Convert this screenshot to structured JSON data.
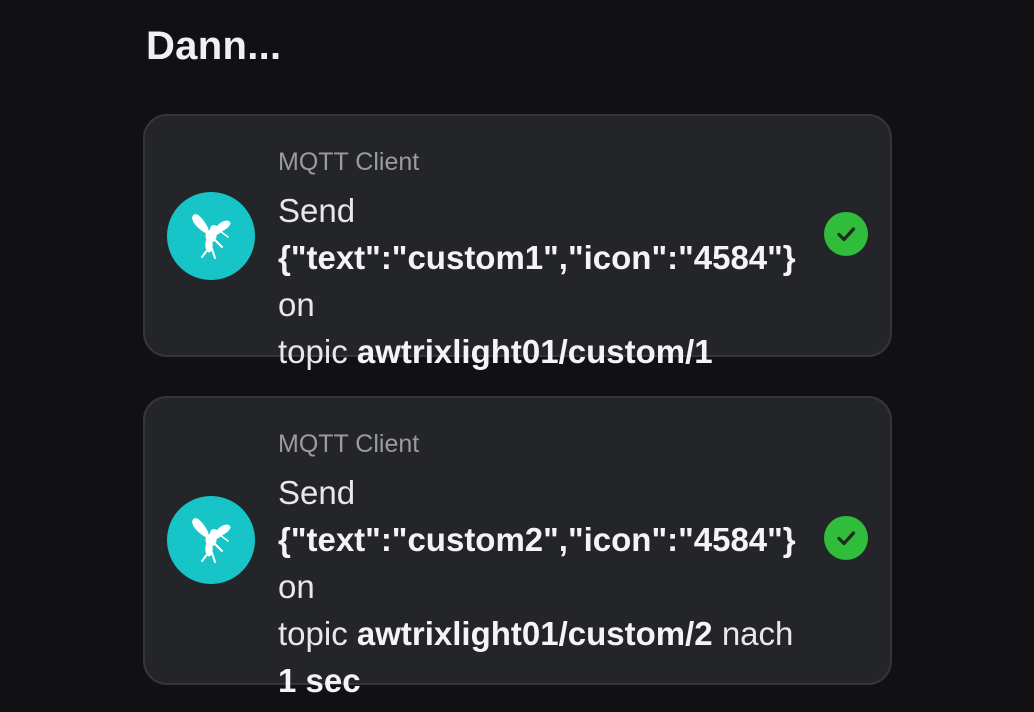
{
  "section": {
    "title": "Dann..."
  },
  "colors": {
    "background": "#111114",
    "card": "#242529",
    "icon_bg": "#17c4c8",
    "success": "#2fbd3b"
  },
  "actions": [
    {
      "app": "MQTT Client",
      "icon": "mosquitto-icon",
      "status_icon": "check-circle-icon",
      "send": "Send",
      "payload": "{\"text\":\"custom1\",\"icon\":\"4584\"}",
      "on": "on",
      "topic_label": "topic",
      "topic": "awtrixlight01/custom/1"
    },
    {
      "app": "MQTT Client",
      "icon": "mosquitto-icon",
      "status_icon": "check-circle-icon",
      "send": "Send",
      "payload": "{\"text\":\"custom2\",\"icon\":\"4584\"}",
      "on": "on",
      "topic_label": "topic",
      "topic": "awtrixlight01/custom/2",
      "delay_label": "nach",
      "delay": "1 sec"
    }
  ]
}
